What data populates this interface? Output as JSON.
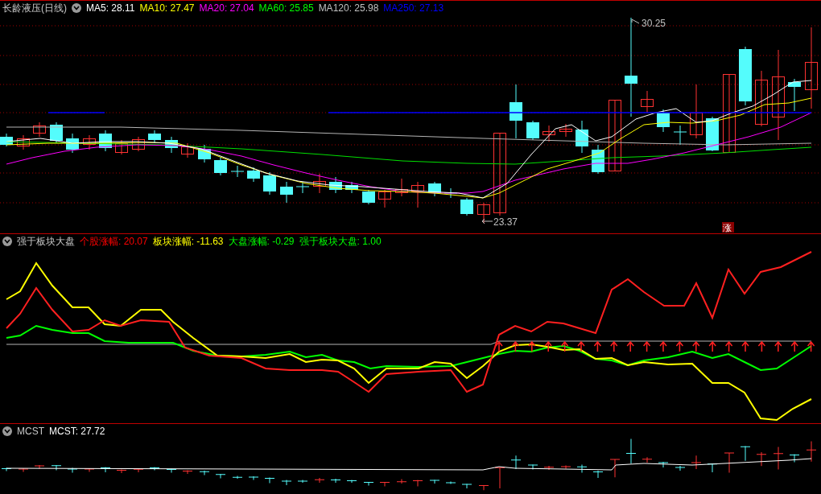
{
  "main_panel": {
    "title": "长龄液压(日线)",
    "indicators": [
      {
        "text": "MA5: 28.11",
        "color": "#ffffff"
      },
      {
        "text": "MA10: 27.47",
        "color": "#ffff00"
      },
      {
        "text": "MA20: 27.04",
        "color": "#ff00ff"
      },
      {
        "text": "MA60: 25.85",
        "color": "#00ff00"
      },
      {
        "text": "MA120: 25.98",
        "color": "#c0c0c0"
      },
      {
        "text": "MA250: 27.13",
        "color": "#0000ff"
      }
    ],
    "high_label": "30.25",
    "low_label": "23.37",
    "badge": "涨"
  },
  "strength_panel": {
    "title": "强于板块大盘",
    "indicators": [
      {
        "text": "个股涨幅: 20.07",
        "color": "#ff0000"
      },
      {
        "text": "板块涨幅: -11.63",
        "color": "#ffff00"
      },
      {
        "text": "大盘涨幅: -0.29",
        "color": "#00ff00"
      },
      {
        "text": "强于板块大盘: 1.00",
        "color": "#00ff00"
      }
    ]
  },
  "mcst_panel": {
    "title": "MCST",
    "indicators": [
      {
        "text": "MCST: 27.72",
        "color": "#ffffff"
      }
    ]
  }
}
